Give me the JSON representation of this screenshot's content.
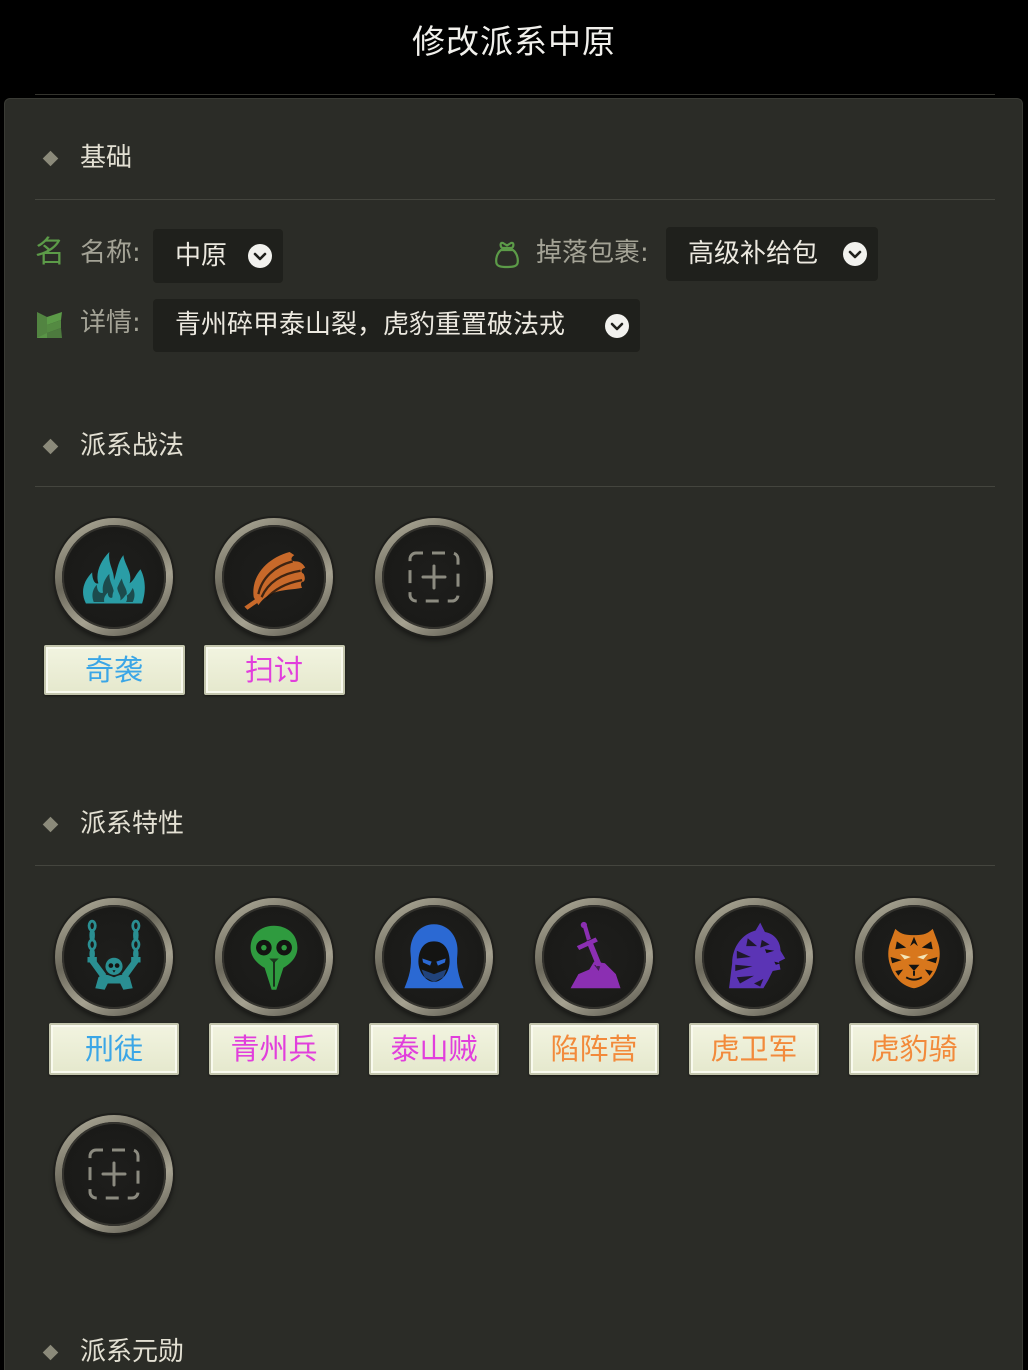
{
  "header": {
    "title": "修改派系中原"
  },
  "basic": {
    "title": "基础",
    "name": {
      "icon_char": "名",
      "label": "名称:",
      "value": "中原"
    },
    "drop": {
      "icon": "bag-icon",
      "label": "掉落包裹:",
      "value": "高级补给包"
    },
    "detail": {
      "icon": "scroll-icon",
      "label": "详情:",
      "value": "青州碎甲泰山裂，虎豹重置破法戎"
    }
  },
  "tactics": {
    "title": "派系战法",
    "items": [
      {
        "label": "奇袭",
        "icon": "teal-flame-icon",
        "label_color": "#3ba6e6",
        "icon_color": "#2a9da6"
      },
      {
        "label": "扫讨",
        "icon": "orange-claw-icon",
        "label_color": "#e13fdc",
        "icon_color": "#c8692a"
      }
    ],
    "add_icon": "add-icon"
  },
  "traits": {
    "title": "派系特性",
    "items": [
      {
        "label": "刑徒",
        "icon": "chained-prisoner-icon",
        "label_color": "#3ba6e6",
        "icon_color": "#2a8f92"
      },
      {
        "label": "青州兵",
        "icon": "plague-mask-icon",
        "label_color": "#e13fdc",
        "icon_color": "#2f9b3f"
      },
      {
        "label": "泰山贼",
        "icon": "hooded-bandit-icon",
        "label_color": "#e13fdc",
        "icon_color": "#2b69d3"
      },
      {
        "label": "陷阵营",
        "icon": "sword-in-stone-icon",
        "label_color": "#f28a3b",
        "icon_color": "#8b2fb2"
      },
      {
        "label": "虎卫军",
        "icon": "tiger-profile-icon",
        "label_color": "#f28a3b",
        "icon_color": "#5b34b5"
      },
      {
        "label": "虎豹骑",
        "icon": "tiger-face-icon",
        "label_color": "#f28a3b",
        "icon_color": "#d8771c"
      }
    ],
    "add_icon": "add-icon"
  },
  "heroes": {
    "title": "派系元勋"
  },
  "colors": {
    "accent_green": "#5c9b48",
    "panel_bg": "#2b2c27",
    "header_bg": "#000000"
  }
}
